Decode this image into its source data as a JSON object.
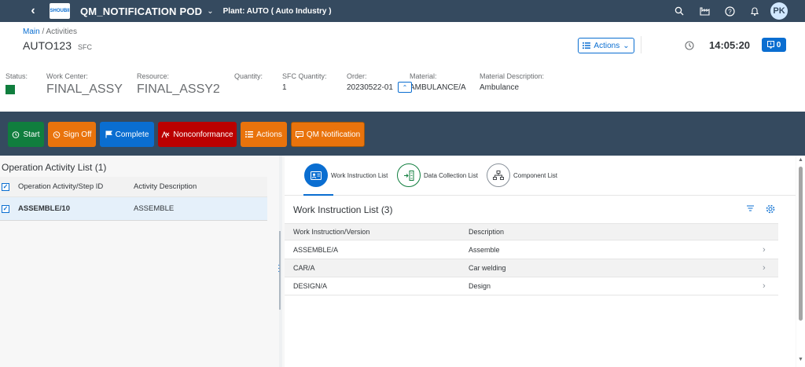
{
  "shell": {
    "logo_text": "SHOUBII",
    "title": "QM_NOTIFICATION POD",
    "plant": "Plant: AUTO ( Auto Industry )",
    "avatar_initials": "PK",
    "icons": [
      "back-icon",
      "search-icon",
      "factory-icon",
      "help-icon",
      "bell-icon"
    ]
  },
  "header": {
    "breadcrumb_main": "Main",
    "breadcrumb_sep": " / ",
    "breadcrumb_current": "Activities",
    "sfc_value": "AUTO123",
    "sfc_tag": "SFC",
    "actions_label": "Actions",
    "time": "14:05:20",
    "alert_count": "0",
    "fields": {
      "status_label": "Status:",
      "status_color": "#107e3e",
      "work_center_label": "Work Center:",
      "work_center_value": "FINAL_ASSY",
      "resource_label": "Resource:",
      "resource_value": "FINAL_ASSY2",
      "quantity_label": "Quantity:",
      "sfc_quantity_label": "SFC Quantity:",
      "sfc_quantity_value": "1",
      "order_label": "Order:",
      "order_value": "20230522-01",
      "material_label": "Material:",
      "material_value": "AMBULANCE/A",
      "material_desc_label": "Material Description:",
      "material_desc_value": "Ambulance"
    }
  },
  "toolbar": {
    "start": "Start",
    "sign_off": "Sign Off",
    "complete": "Complete",
    "nonconformance": "Nonconformance",
    "actions": "Actions",
    "qm_notification": "QM Notification",
    "colors": {
      "start": "#107e3e",
      "sign_off": "#e9730c",
      "complete": "#0a6ed1",
      "nonconformance": "#bb0000",
      "actions": "#e9730c",
      "qm_notification": "#e9730c"
    }
  },
  "operation_list": {
    "title": "Operation Activity List (1)",
    "col_step": "Operation Activity/Step ID",
    "col_desc": "Activity Description",
    "rows": [
      {
        "step": "ASSEMBLE/10",
        "desc": "ASSEMBLE"
      }
    ]
  },
  "tabs": {
    "work_instruction": "Work Instruction List",
    "data_collection": "Data Collection List",
    "component": "Component List"
  },
  "work_instructions": {
    "title": "Work Instruction List (3)",
    "col_version": "Work Instruction/Version",
    "col_desc": "Description",
    "rows": [
      {
        "version": "ASSEMBLE/A",
        "desc": "Assemble"
      },
      {
        "version": "CAR/A",
        "desc": "Car welding"
      },
      {
        "version": "DESIGN/A",
        "desc": "Design"
      }
    ]
  }
}
